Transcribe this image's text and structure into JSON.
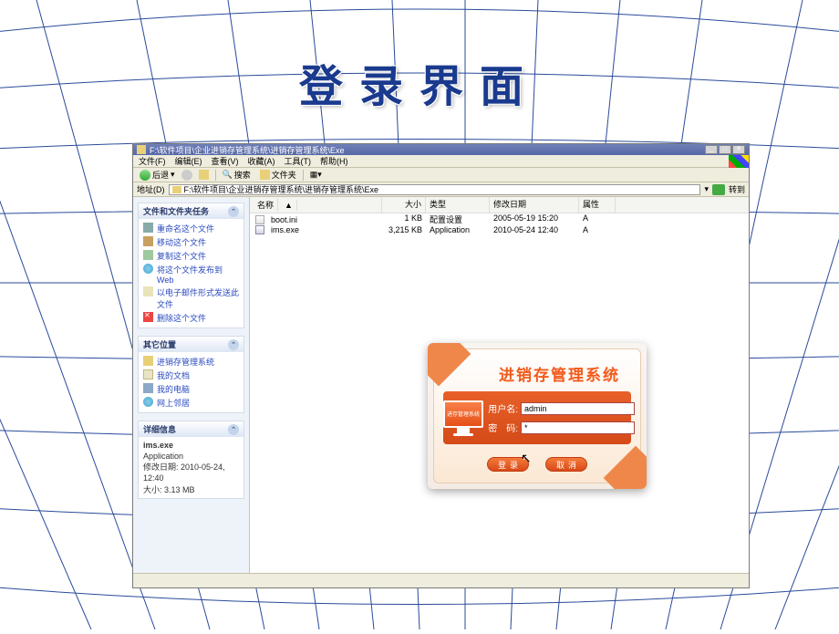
{
  "pageTitle": "登录界面",
  "explorer": {
    "title": "F:\\软件项目\\企业进销存管理系统\\进销存管理系统\\Exe",
    "menu": [
      "文件(F)",
      "编辑(E)",
      "查看(V)",
      "收藏(A)",
      "工具(T)",
      "帮助(H)"
    ],
    "toolbar": {
      "back": "后退",
      "search": "搜索",
      "folders": "文件夹"
    },
    "addressLabel": "地址(D)",
    "addressPath": "F:\\软件项目\\企业进销存管理系统\\进销存管理系统\\Exe",
    "goLabel": "转到",
    "columns": {
      "name": "名称",
      "size": "大小",
      "type": "类型",
      "date": "修改日期",
      "attr": "属性"
    },
    "files": [
      {
        "name": "boot.ini",
        "size": "1 KB",
        "type": "配置设置",
        "date": "2005-05-19 15:20",
        "attr": "A"
      },
      {
        "name": "ims.exe",
        "size": "3,215 KB",
        "type": "Application",
        "date": "2010-05-24 12:40",
        "attr": "A"
      }
    ]
  },
  "sidebar": {
    "tasksTitle": "文件和文件夹任务",
    "tasks": [
      "重命名这个文件",
      "移动这个文件",
      "复制这个文件",
      "将这个文件发布到 Web",
      "以电子邮件形式发送此文件",
      "删除这个文件"
    ],
    "otherTitle": "其它位置",
    "other": [
      "进销存管理系统",
      "我的文档",
      "我的电脑",
      "网上邻居"
    ],
    "detailsTitle": "详细信息",
    "details": {
      "name": "ims.exe",
      "type": "Application",
      "dateLabel": "修改日期:",
      "date": "2010-05-24, 12:40",
      "sizeLabel": "大小:",
      "size": "3.13 MB"
    }
  },
  "login": {
    "systemName": "进销存管理系统",
    "screenText": "进存管理系统",
    "userLabel": "用户名:",
    "userValue": "admin",
    "passLabel": "密　码:",
    "passValue": "*",
    "loginBtn": "登录",
    "cancelBtn": "取消"
  }
}
